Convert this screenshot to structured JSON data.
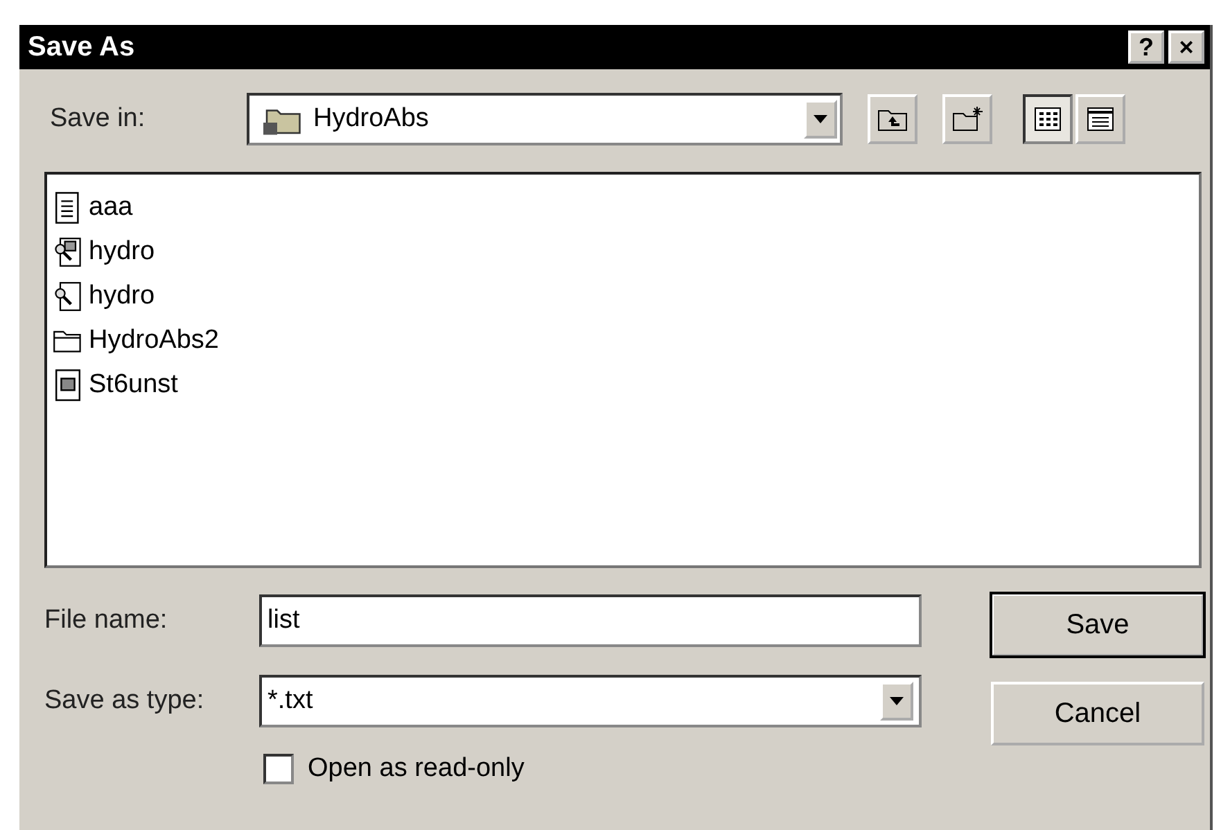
{
  "window": {
    "title": "Save As",
    "title_buttons": [
      "?",
      "×"
    ]
  },
  "save_in": {
    "label": "Save in:",
    "value": "HydroAbs"
  },
  "view_buttons": [
    {
      "kind": "list",
      "selected": true
    },
    {
      "kind": "details",
      "selected": false
    }
  ],
  "files": [
    {
      "name": "aaa",
      "kind": "text"
    },
    {
      "name": "hydro",
      "kind": "web"
    },
    {
      "name": "hydro",
      "kind": "web2"
    },
    {
      "name": "HydroAbs2",
      "kind": "folder"
    },
    {
      "name": "St6unst",
      "kind": "program"
    }
  ],
  "file_name": {
    "label": "File name:",
    "value": "list"
  },
  "save_as_type": {
    "label": "Save as type:",
    "value": "*.txt"
  },
  "buttons": [
    "Save",
    "Cancel"
  ],
  "read_only": {
    "label": "Open as read-only",
    "checked": false
  }
}
